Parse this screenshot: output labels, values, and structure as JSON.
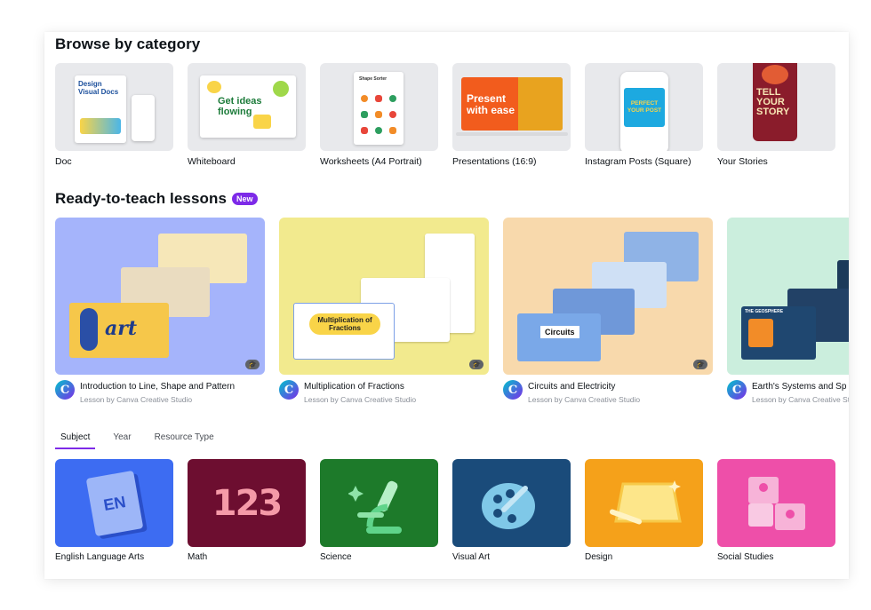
{
  "browse": {
    "heading": "Browse by category",
    "categories": [
      {
        "label": "Doc",
        "art": "Design Visual Docs"
      },
      {
        "label": "Whiteboard",
        "art": "Get ideas flowing"
      },
      {
        "label": "Worksheets (A4 Portrait)",
        "art": "Shape Sorter"
      },
      {
        "label": "Presentations (16:9)",
        "art": "Present with ease"
      },
      {
        "label": "Instagram Posts (Square)",
        "art": "PERFECT YOUR POST"
      },
      {
        "label": "Your Stories",
        "art": "TELL YOUR STORY"
      }
    ]
  },
  "lessons": {
    "heading": "Ready-to-teach lessons",
    "badge": "New",
    "items": [
      {
        "title": "Introduction to Line, Shape and Pattern",
        "sub": "Lesson by Canva Creative Studio",
        "art": "art",
        "bg": "#a5b4fb"
      },
      {
        "title": "Multiplication of Fractions",
        "sub": "Lesson by Canva Creative Studio",
        "art": "Multiplication of Fractions",
        "bg": "#f2ea8e"
      },
      {
        "title": "Circuits and Electricity",
        "sub": "Lesson by Canva Creative Studio",
        "art": "Circuits",
        "bg": "#f8d9ac"
      },
      {
        "title": "Earth's Systems and Sp",
        "sub": "Lesson by Canva Creative Stu",
        "art": "THE GEOSPHERE",
        "bg": "#cbeedd"
      }
    ]
  },
  "tabs": [
    {
      "label": "Subject",
      "active": true
    },
    {
      "label": "Year",
      "active": false
    },
    {
      "label": "Resource Type",
      "active": false
    }
  ],
  "subjects": [
    {
      "label": "English Language Arts",
      "bg": "#3d6cf2",
      "art": "EN",
      "icon": "book-icon"
    },
    {
      "label": "Math",
      "bg": "#6d0e30",
      "art": "123",
      "icon": "numbers-icon"
    },
    {
      "label": "Science",
      "bg": "#1d7a2a",
      "art": "",
      "icon": "microscope-icon"
    },
    {
      "label": "Visual Art",
      "bg": "#1a4b7a",
      "art": "",
      "icon": "palette-icon"
    },
    {
      "label": "Design",
      "bg": "#f5a11a",
      "art": "",
      "icon": "tablet-pen-icon"
    },
    {
      "label": "Social Studies",
      "bg": "#ee4fa9",
      "art": "",
      "icon": "puzzle-icon"
    }
  ]
}
